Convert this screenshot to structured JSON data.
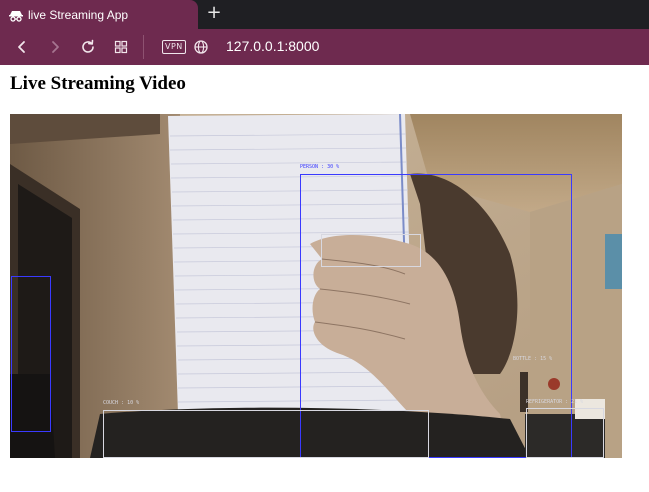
{
  "browser": {
    "tab_title": "live Streaming App",
    "tab_icon": "incognito-icon",
    "new_tab_symbol": "+",
    "vpn_label": "VPN",
    "url": "127.0.0.1:8000",
    "colors": {
      "chrome_accent": "#6e2a4f",
      "tabbar_background": "#1f1f23"
    },
    "toolbar_icons": [
      "back-arrow-icon",
      "forward-arrow-icon",
      "reload-icon",
      "tabs-grid-icon",
      "vpn-badge",
      "globe-icon"
    ]
  },
  "page": {
    "heading": "Live Streaming Video"
  },
  "video": {
    "description_colors": {
      "wall": "#9a7e62",
      "paper": "#e9e9ef",
      "detection_blue": "#3a3aff",
      "detection_white": "#d8d8e0"
    },
    "detections": [
      {
        "label": "PERSON : 30 %",
        "color": "#3a3aff"
      },
      {
        "label": "",
        "color": "#d8d8e0"
      },
      {
        "label": "COUCH : 10 %",
        "color": "#d8d8e0"
      },
      {
        "label": "BOTTLE : 15 %",
        "color": "#d8d8e0"
      },
      {
        "label": "REFRIGERATOR : 21 %",
        "color": "#d8d8e0"
      },
      {
        "label": "",
        "color": "#3a3aff"
      }
    ]
  }
}
